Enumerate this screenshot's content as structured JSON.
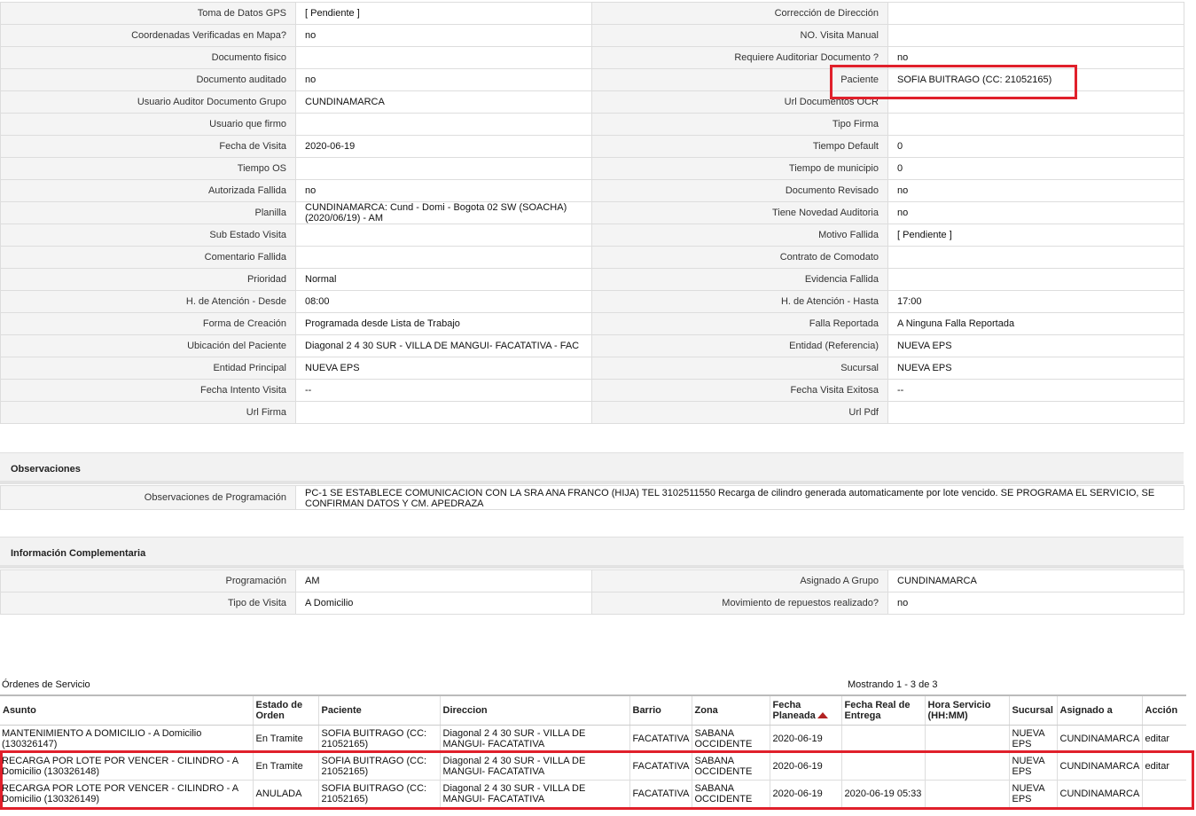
{
  "details": {
    "rows": [
      {
        "l1": "Toma de Datos GPS",
        "v1": "[ Pendiente ]",
        "l2": "Corrección de Dirección",
        "v2": ""
      },
      {
        "l1": "Coordenadas Verificadas en Mapa?",
        "v1": " no",
        "l2": "NO. Visita Manual",
        "v2": ""
      },
      {
        "l1": "Documento fisico",
        "v1": "",
        "l2": "Requiere Auditoriar Documento ?",
        "v2": " no"
      },
      {
        "l1": "Documento auditado",
        "v1": " no",
        "l2": "Paciente",
        "v2": "SOFIA BUITRAGO (CC: 21052165)"
      },
      {
        "l1": "Usuario Auditor Documento Grupo",
        "v1": "CUNDINAMARCA",
        "l2": "Url Documentos OCR",
        "v2": ""
      },
      {
        "l1": "Usuario que firmo",
        "v1": "",
        "l2": "Tipo Firma",
        "v2": ""
      },
      {
        "l1": "Fecha de Visita",
        "v1": " 2020-06-19",
        "l2": "Tiempo Default",
        "v2": "0"
      },
      {
        "l1": "Tiempo OS",
        "v1": "",
        "l2": "Tiempo de municipio",
        "v2": "0"
      },
      {
        "l1": "Autorizada Fallida",
        "v1": " no",
        "l2": "Documento Revisado",
        "v2": " no"
      },
      {
        "l1": "Planilla",
        "v1": "CUNDINAMARCA: Cund - Domi - Bogota 02 SW (SOACHA) (2020/06/19) - AM",
        "l2": "Tiene Novedad Auditoria",
        "v2": " no"
      },
      {
        "l1": "Sub Estado Visita",
        "v1": "",
        "l2": "Motivo Fallida",
        "v2": "[ Pendiente ]"
      },
      {
        "l1": "Comentario Fallida",
        "v1": "",
        "l2": "Contrato de Comodato",
        "v2": ""
      },
      {
        "l1": "Prioridad",
        "v1": "Normal",
        "l2": "Evidencia Fallida",
        "v2": ""
      },
      {
        "l1": "H. de Atención - Desde",
        "v1": "08:00",
        "l2": "H. de Atención - Hasta",
        "v2": "17:00"
      },
      {
        "l1": "Forma de Creación",
        "v1": "Programada desde Lista de Trabajo",
        "l2": "Falla Reportada",
        "v2": "A Ninguna Falla Reportada"
      },
      {
        "l1": "Ubicación del Paciente",
        "v1": "Diagonal 2 4 30 SUR - VILLA DE MANGUI- FACATATIVA - FAC",
        "l2": "Entidad (Referencia)",
        "v2": "NUEVA EPS"
      },
      {
        "l1": "Entidad Principal",
        "v1": "NUEVA EPS",
        "l2": "Sucursal",
        "v2": "NUEVA EPS"
      },
      {
        "l1": "Fecha Intento Visita",
        "v1": " --",
        "l2": "Fecha Visita Exitosa",
        "v2": " --"
      },
      {
        "l1": "Url Firma",
        "v1": "",
        "l2": "Url Pdf",
        "v2": ""
      }
    ]
  },
  "observaciones": {
    "title": "Observaciones",
    "label": "Observaciones de Programación",
    "value": "  PC-1 SE ESTABLECE COMUNICACION CON LA SRA ANA FRANCO (HIJA) TEL 3102511550 Recarga de cilindro generada automaticamente por lote vencido. SE PROGRAMA EL SERVICIO, SE CONFIRMAN DATOS Y CM. APEDRAZA"
  },
  "complementaria": {
    "title": "Información Complementaria",
    "rows": [
      {
        "l1": "Programación",
        "v1": "AM",
        "l2": "Asignado A Grupo",
        "v2": "CUNDINAMARCA"
      },
      {
        "l1": "Tipo de Visita",
        "v1": "A Domicilio",
        "l2": "Movimiento de repuestos realizado?",
        "v2": " no"
      }
    ]
  },
  "orders": {
    "title": "Órdenes de Servicio",
    "count": "Mostrando 1 - 3 de 3",
    "headers": {
      "asunto": "Asunto",
      "estado": "Estado de Orden",
      "paciente": "Paciente",
      "direccion": "Direccion",
      "barrio": "Barrio",
      "zona": "Zona",
      "fecha_planeada": "Fecha Planeada",
      "fecha_real": "Fecha Real de Entrega",
      "hora": "Hora Servicio (HH:MM)",
      "sucursal": "Sucursal",
      "asignado": "Asignado a",
      "accion": "Acción"
    },
    "rows": [
      {
        "asunto": "MANTENIMIENTO A DOMICILIO - A Domicilio (130326147)",
        "estado": "En Tramite",
        "paciente": "SOFIA BUITRAGO (CC: 21052165)",
        "direccion": "Diagonal 2 4 30 SUR - VILLA DE MANGUI- FACATATIVA",
        "barrio": "FACATATIVA",
        "zona": "SABANA OCCIDENTE",
        "fecha_planeada": "2020-06-19",
        "fecha_real": "",
        "hora": "",
        "sucursal": "NUEVA EPS",
        "asignado": "CUNDINAMARCA",
        "accion": "editar"
      },
      {
        "asunto": "RECARGA POR LOTE POR VENCER - CILINDRO - A Domicilio (130326148)",
        "estado": "En Tramite",
        "paciente": "SOFIA BUITRAGO (CC: 21052165)",
        "direccion": "Diagonal 2 4 30 SUR - VILLA DE MANGUI- FACATATIVA",
        "barrio": "FACATATIVA",
        "zona": "SABANA OCCIDENTE",
        "fecha_planeada": "2020-06-19",
        "fecha_real": "",
        "hora": "",
        "sucursal": "NUEVA EPS",
        "asignado": "CUNDINAMARCA",
        "accion": "editar"
      },
      {
        "asunto": "RECARGA POR LOTE POR VENCER - CILINDRO - A Domicilio (130326149)",
        "estado": "ANULADA",
        "paciente": "SOFIA BUITRAGO (CC: 21052165)",
        "direccion": "Diagonal 2 4 30 SUR - VILLA DE MANGUI- FACATATIVA",
        "barrio": "FACATATIVA",
        "zona": "SABANA OCCIDENTE",
        "fecha_planeada": "2020-06-19",
        "fecha_real": "2020-06-19 05:33",
        "hora": "",
        "sucursal": "NUEVA EPS",
        "asignado": "CUNDINAMARCA",
        "accion": ""
      }
    ]
  },
  "colors": {
    "highlight": "#e0202b",
    "label_bg": "#f4f4f4",
    "section_bg": "#f2f2f2"
  }
}
